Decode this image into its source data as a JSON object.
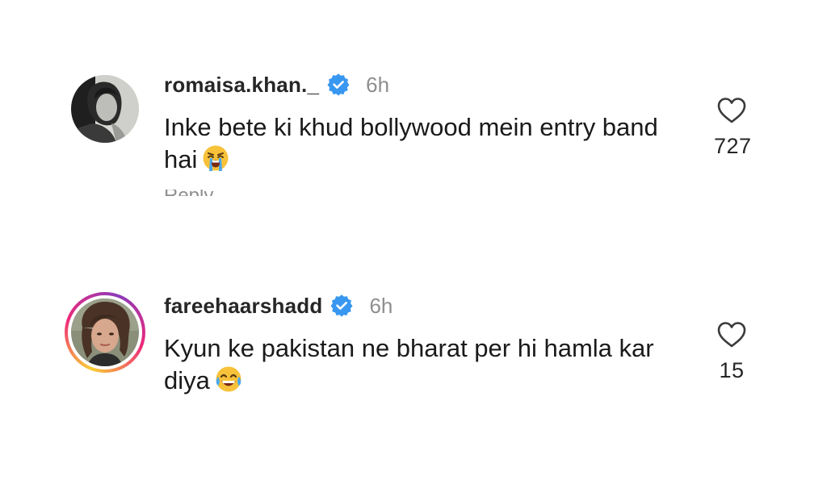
{
  "comments": [
    {
      "username": "romaisa.khan._",
      "verified": true,
      "time": "6h",
      "text": "Inke bete ki khud bollywood mein entry band hai",
      "emoji": "loudly-crying-face",
      "likes": "727",
      "reply_label": "Reply",
      "avatar_icon": "avatar-romaisa",
      "has_story_ring": false
    },
    {
      "username": "fareehaarshadd",
      "verified": true,
      "time": "6h",
      "text": "Kyun ke pakistan ne bharat per hi hamla kar diya",
      "emoji": "face-with-tears-of-joy",
      "likes": "15",
      "avatar_icon": "avatar-fareeha",
      "has_story_ring": true
    }
  ],
  "colors": {
    "verified_badge": "#3897f0",
    "muted_text": "#8e8e8e",
    "story_ring": [
      "#f9ce34",
      "#ee2a7b",
      "#8a3ab9"
    ]
  }
}
